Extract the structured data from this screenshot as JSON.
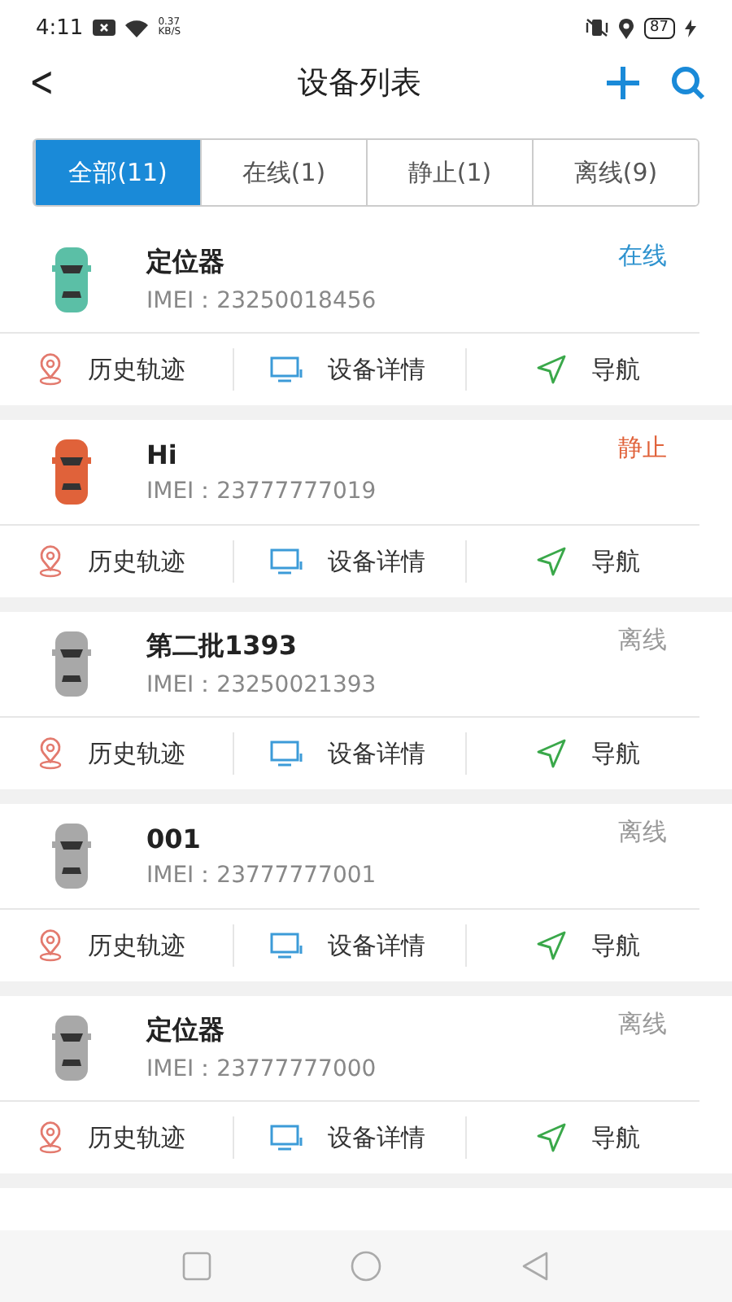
{
  "status_bar": {
    "time": "4:11",
    "speed_value": "0.37",
    "speed_unit": "KB/S",
    "battery": "87"
  },
  "header": {
    "back": "<",
    "title": "设备列表"
  },
  "tabs": [
    {
      "label": "全部(11)",
      "selected": true
    },
    {
      "label": "在线(1)",
      "selected": false
    },
    {
      "label": "静止(1)",
      "selected": false
    },
    {
      "label": "离线(9)",
      "selected": false
    }
  ],
  "devices": [
    {
      "name": "定位器",
      "imei": "IMEI：23250018456",
      "status": "在线",
      "kind": "online",
      "color": "#5bbfa6",
      "actions": [
        "历史轨迹",
        "设备详情",
        "导航"
      ]
    },
    {
      "name": "Hi",
      "imei": "IMEI：23777777019",
      "status": "静止",
      "kind": "static",
      "color": "#e0623a",
      "actions": [
        "历史轨迹",
        "设备详情",
        "导航"
      ]
    },
    {
      "name": "第二批1393",
      "imei": "IMEI：23250021393",
      "status": "离线",
      "kind": "offline",
      "color": "#a8a8a8",
      "actions": [
        "历史轨迹",
        "设备详情",
        "导航"
      ]
    },
    {
      "name": "001",
      "imei": "IMEI：23777777001",
      "status": "离线",
      "kind": "offline",
      "color": "#a8a8a8",
      "actions": [
        "历史轨迹",
        "设备详情",
        "导航"
      ]
    },
    {
      "name": "定位器",
      "imei": "IMEI：23777777000",
      "status": "离线",
      "kind": "offline",
      "color": "#a8a8a8",
      "actions": [
        "历史轨迹",
        "设备详情",
        "导航"
      ]
    }
  ]
}
